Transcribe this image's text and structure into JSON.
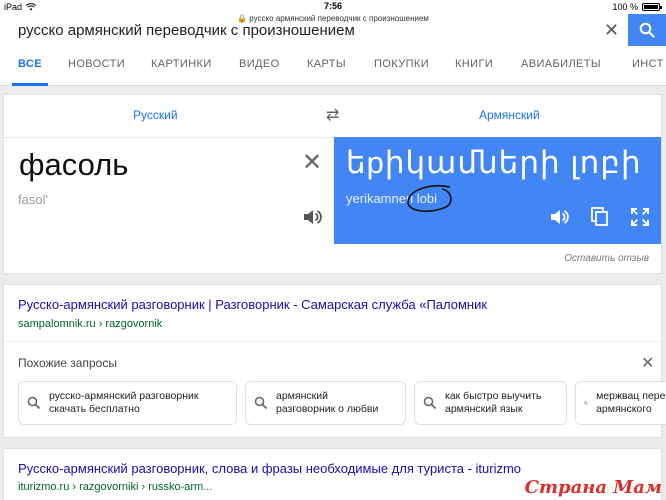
{
  "status_bar": {
    "device": "iPad",
    "time": "7:56",
    "url": "русско армянский переводчик с произношением",
    "battery": "100 %"
  },
  "search": {
    "query": "русско армянский переводчик с произношением"
  },
  "tabs": [
    {
      "label": "ВСЕ"
    },
    {
      "label": "НОВОСТИ"
    },
    {
      "label": "КАРТИНКИ"
    },
    {
      "label": "ВИДЕО"
    },
    {
      "label": "КАРТЫ"
    },
    {
      "label": "ПОКУПКИ"
    },
    {
      "label": "КНИГИ"
    },
    {
      "label": "АВИАБИЛЕТЫ"
    },
    {
      "label": "ИНСТ"
    }
  ],
  "translate": {
    "source_lang": "Русский",
    "target_lang": "Армянский",
    "source_text": "фасоль",
    "source_translit": "fasol'",
    "target_text": "եpիկամների լոբի",
    "target_translit": "yerikamneri lobi",
    "feedback": "Оставить отзыв"
  },
  "result1": {
    "title": "Русско-армянский разговорник | Разговорник - Самарская служба «Паломник",
    "url": "sampalomnik.ru › razgovornik"
  },
  "similar": {
    "title": "Похожие запросы",
    "chips": [
      {
        "line1": "русско-армянский разговорник",
        "line2": "скачать бесплатно"
      },
      {
        "line1": "армянский",
        "line2": "разговорник о любви"
      },
      {
        "line1": "как быстро выучить",
        "line2": "армянский язык"
      },
      {
        "line1": "мержвац перев",
        "line2": "армянского"
      }
    ]
  },
  "result2": {
    "title": "Русско-армянский разговорник, слова и фразы необходимые для туриста - iturizmo",
    "url": "iturizmo.ru › razgovorniki › russko-arm..."
  },
  "watermark": "Страна Мам",
  "colors": {
    "accent": "#4285f4",
    "link": "#1a0dab",
    "url": "#006621"
  }
}
